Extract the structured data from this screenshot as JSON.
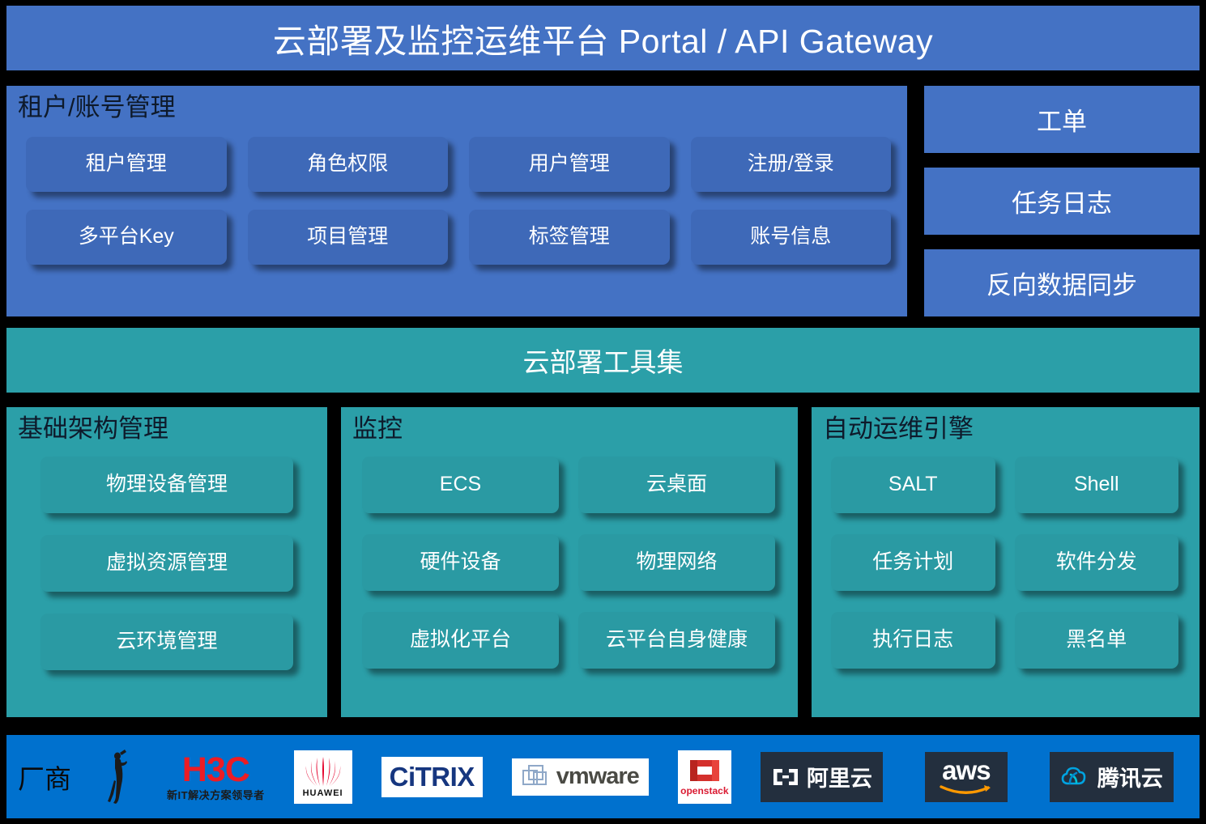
{
  "header": {
    "title": "云部署及监控运维平台 Portal / API Gateway"
  },
  "tenant_panel": {
    "heading": "租户/账号管理",
    "tiles": [
      {
        "label": "租户管理"
      },
      {
        "label": "角色权限"
      },
      {
        "label": "用户管理"
      },
      {
        "label": "注册/登录"
      },
      {
        "label": "多平台Key"
      },
      {
        "label": "项目管理"
      },
      {
        "label": "标签管理"
      },
      {
        "label": "账号信息"
      }
    ]
  },
  "right_stack": {
    "blocks": [
      {
        "label": "工单"
      },
      {
        "label": "任务日志"
      },
      {
        "label": "反向数据同步"
      }
    ]
  },
  "toolbar_band": {
    "title": "云部署工具集"
  },
  "infra_panel": {
    "heading": "基础架构管理",
    "tiles": [
      {
        "label": "物理设备管理"
      },
      {
        "label": "虚拟资源管理"
      },
      {
        "label": "云环境管理"
      }
    ]
  },
  "monitor_panel": {
    "heading": "监控",
    "tiles": [
      {
        "label": "ECS"
      },
      {
        "label": "云桌面"
      },
      {
        "label": "硬件设备"
      },
      {
        "label": "物理网络"
      },
      {
        "label": "虚拟化平台"
      },
      {
        "label": "云平台\n自身健康"
      }
    ]
  },
  "autoops_panel": {
    "heading": "自动运维引擎",
    "tiles": [
      {
        "label": "SALT"
      },
      {
        "label": "Shell"
      },
      {
        "label": "任务计划"
      },
      {
        "label": "软件分发"
      },
      {
        "label": "执行日志"
      },
      {
        "label": "黑名单"
      }
    ]
  },
  "vendor_bar": {
    "label": "厂商",
    "logos": [
      {
        "icon": "statue-figure-icon",
        "name": ""
      },
      {
        "icon": "h3c-logo-icon",
        "name": "H3C",
        "subtitle": "新IT解决方案领导者"
      },
      {
        "icon": "huawei-logo-icon",
        "name": "HUAWEI"
      },
      {
        "icon": "citrix-logo-icon",
        "name": "CiTRIX"
      },
      {
        "icon": "vmware-logo-icon",
        "name": "vmware"
      },
      {
        "icon": "openstack-logo-icon",
        "name": "openstack"
      },
      {
        "icon": "aliyun-logo-icon",
        "name": "阿里云"
      },
      {
        "icon": "aws-logo-icon",
        "name": "aws"
      },
      {
        "icon": "tencentcloud-logo-icon",
        "name": "腾讯云"
      }
    ]
  },
  "colors": {
    "header_blue": "#4472C4",
    "tile_blue": "#3E69B8",
    "teal_panel": "#2B9FA8",
    "tile_teal": "#2A9AA3",
    "vendor_blue": "#0071CE",
    "background": "#000000"
  }
}
